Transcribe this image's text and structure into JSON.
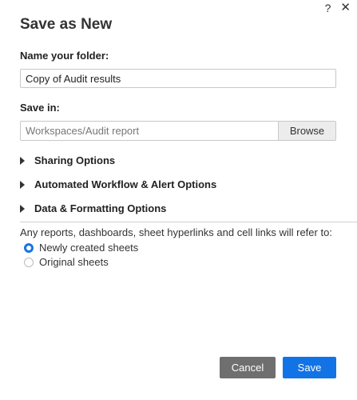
{
  "dialog": {
    "title": "Save as New",
    "help_glyph": "?",
    "close_glyph": "✕"
  },
  "name_field": {
    "label": "Name your folder:",
    "value": "Copy of Audit results"
  },
  "save_in": {
    "label": "Save in:",
    "path": "Workspaces/Audit report",
    "browse_label": "Browse"
  },
  "sections": [
    {
      "label": "Sharing Options",
      "expanded": false
    },
    {
      "label": "Automated Workflow & Alert Options",
      "expanded": false
    },
    {
      "label": "Data & Formatting Options",
      "expanded": false
    }
  ],
  "refer": {
    "text": "Any reports, dashboards, sheet hyperlinks and cell links will refer to:",
    "options": [
      {
        "label": "Newly created sheets",
        "selected": true
      },
      {
        "label": "Original sheets",
        "selected": false
      }
    ]
  },
  "footer": {
    "cancel_label": "Cancel",
    "save_label": "Save"
  },
  "colors": {
    "primary": "#1273e6",
    "secondary_button": "#6f6f6f",
    "radio_selected": "#1a73e8"
  }
}
